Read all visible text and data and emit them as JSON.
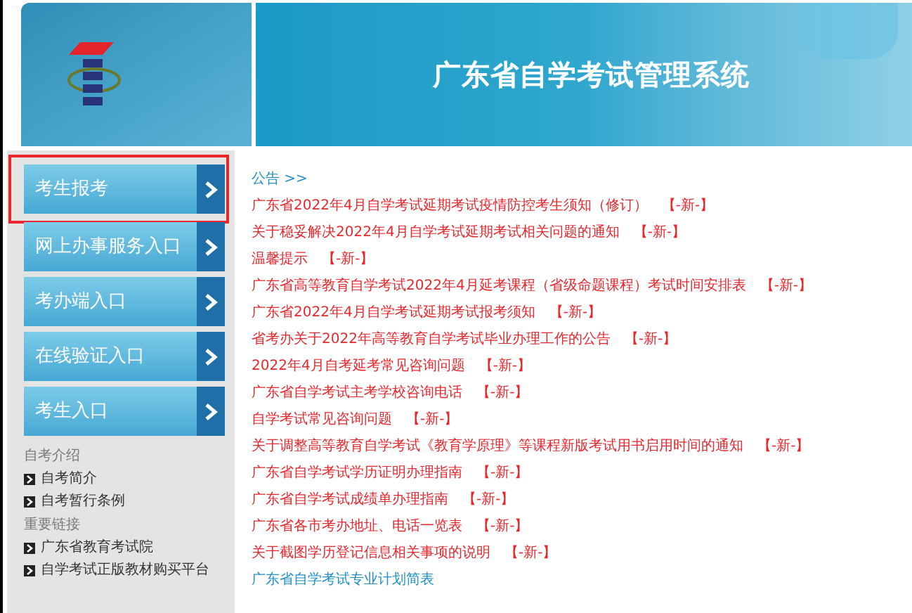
{
  "header": {
    "title": "广东省自学考试管理系统"
  },
  "nav_buttons": [
    {
      "label": "考生报考",
      "highlighted": true
    },
    {
      "label": "网上办事服务入口",
      "highlighted": false
    },
    {
      "label": "考办端入口",
      "highlighted": false
    },
    {
      "label": "在线验证入口",
      "highlighted": false
    },
    {
      "label": "考生入口",
      "highlighted": false
    }
  ],
  "sidebar_sections": [
    {
      "heading": "自考介绍",
      "links": [
        "自考简介",
        "自考暂行条例"
      ]
    },
    {
      "heading": "重要链接",
      "links": [
        "广东省教育考试院",
        "自学考试正版教材购买平台"
      ]
    }
  ],
  "notices": {
    "heading": "公告 >>",
    "items": [
      {
        "text": "广东省2022年4月自学考试延期考试疫情防控考生须知（修订）",
        "tag": "【-新-】",
        "kind": "new"
      },
      {
        "text": "关于稳妥解决2022年4月自学考试延期考试相关问题的通知",
        "tag": "【-新-】",
        "kind": "new"
      },
      {
        "text": "温馨提示",
        "tag": "【-新-】",
        "kind": "new"
      },
      {
        "text": "广东省高等教育自学考试2022年4月延考课程（省级命题课程）考试时间安排表",
        "tag": "【-新-】",
        "kind": "new"
      },
      {
        "text": "广东省2022年4月自学考试延期考试报考须知",
        "tag": "【-新-】",
        "kind": "new"
      },
      {
        "text": "省考办关于2022年高等教育自学考试毕业办理工作的公告",
        "tag": "【-新-】",
        "kind": "new"
      },
      {
        "text": "2022年4月自考延考常见咨询问题",
        "tag": "【-新-】",
        "kind": "new"
      },
      {
        "text": "广东省自学考试主考学校咨询电话",
        "tag": "【-新-】",
        "kind": "new"
      },
      {
        "text": "自学考试常见咨询问题",
        "tag": "【-新-】",
        "kind": "new"
      },
      {
        "text": "关于调整高等教育自学考试《教育学原理》等课程新版考试用书启用时间的通知",
        "tag": "【-新-】",
        "kind": "new"
      },
      {
        "text": "广东省自学考试学历证明办理指南",
        "tag": "【-新-】",
        "kind": "new"
      },
      {
        "text": "广东省自学考试成绩单办理指南",
        "tag": "【-新-】",
        "kind": "new"
      },
      {
        "text": "广东省各市考办地址、电话一览表",
        "tag": "【-新-】",
        "kind": "new"
      },
      {
        "text": "关于截图学历登记信息相关事项的说明",
        "tag": "【-新-】",
        "kind": "new"
      },
      {
        "text": "广东省自学考试专业计划简表",
        "kind": "plain"
      }
    ]
  }
}
